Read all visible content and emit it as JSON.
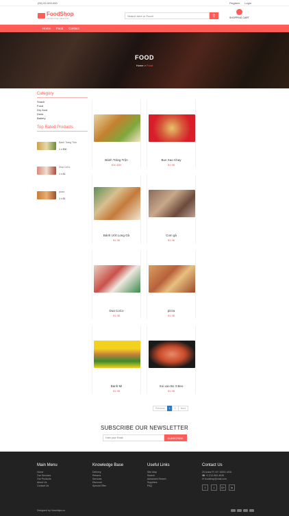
{
  "topbar": {
    "phone": "(00) 62-000-000",
    "register": "Register",
    "login": "Login"
  },
  "header": {
    "logo_title": "FoodShop",
    "logo_tagline": "FOOD FOR HEALTHY",
    "search_placeholder": "Search here or Food!",
    "cart_label": "SHOPPING CART"
  },
  "nav": {
    "items": [
      "Home",
      "Food",
      "Contact"
    ]
  },
  "hero": {
    "title": "FOOD",
    "breadcrumb_home": "Home",
    "breadcrumb_sep": ">",
    "breadcrumb_current": "Food"
  },
  "sidebar": {
    "category_title": "Category",
    "categories": [
      "Snack",
      "Food",
      "Dry food",
      "Drink",
      "Bakery"
    ],
    "top_rated_title": "Top Rated Products",
    "top_rated": [
      {
        "name": "Bánh Tráng Trộn",
        "price": "1 x $30"
      },
      {
        "name": "Dua CoCo",
        "price": "1 x $1"
      },
      {
        "name": "pizza",
        "price": "1 x $1"
      }
    ]
  },
  "products": [
    {
      "name": "Bánh Tráng Trộn",
      "price": "$30 $50"
    },
    {
      "name": "Bun Xao Chay",
      "price": "$1.9$"
    },
    {
      "name": "Bánh Ướt Long Gà",
      "price": "$1.9$"
    },
    {
      "name": "Com gà",
      "price": "$1.9$"
    },
    {
      "name": "Dua CoCo",
      "price": "$1.9$"
    },
    {
      "name": "pizza",
      "price": "$1.9$"
    },
    {
      "name": "Banh Mi",
      "price": "$1.9$"
    },
    {
      "name": "Xoi xao Bo 3 Beo",
      "price": "$1.9$"
    }
  ],
  "pagination": {
    "prev": "Previous",
    "page1": "1",
    "page2": "2",
    "next": "Next"
  },
  "newsletter": {
    "title": "SUBSCRIBE OUR NEWSLETTER",
    "placeholder": "Enter your Email",
    "button": "SUBSCRIBE"
  },
  "footer": {
    "main_menu": {
      "title": "Main Menu",
      "items": [
        "Home",
        "Our Services",
        "Our Products",
        "About Us",
        "Contact Us"
      ]
    },
    "knowledge": {
      "title": "Knowledge Base",
      "items": [
        "Delivery",
        "Returns",
        "Services",
        "Discount",
        "Special Offer"
      ]
    },
    "useful": {
      "title": "Useful Links",
      "items": [
        "Site Map",
        "Search",
        "Advanced Search",
        "Suppliers",
        "FAQ"
      ]
    },
    "contact": {
      "title": "Contact Us",
      "address": "20 Avina Pl, NY 10001 USA",
      "phone": "+1 212-962-4026",
      "email": "foodshop@mail.com"
    },
    "social": [
      "f",
      "t",
      "G+",
      "in"
    ],
    "copyright": "Designed by Hoanhtips.co"
  }
}
